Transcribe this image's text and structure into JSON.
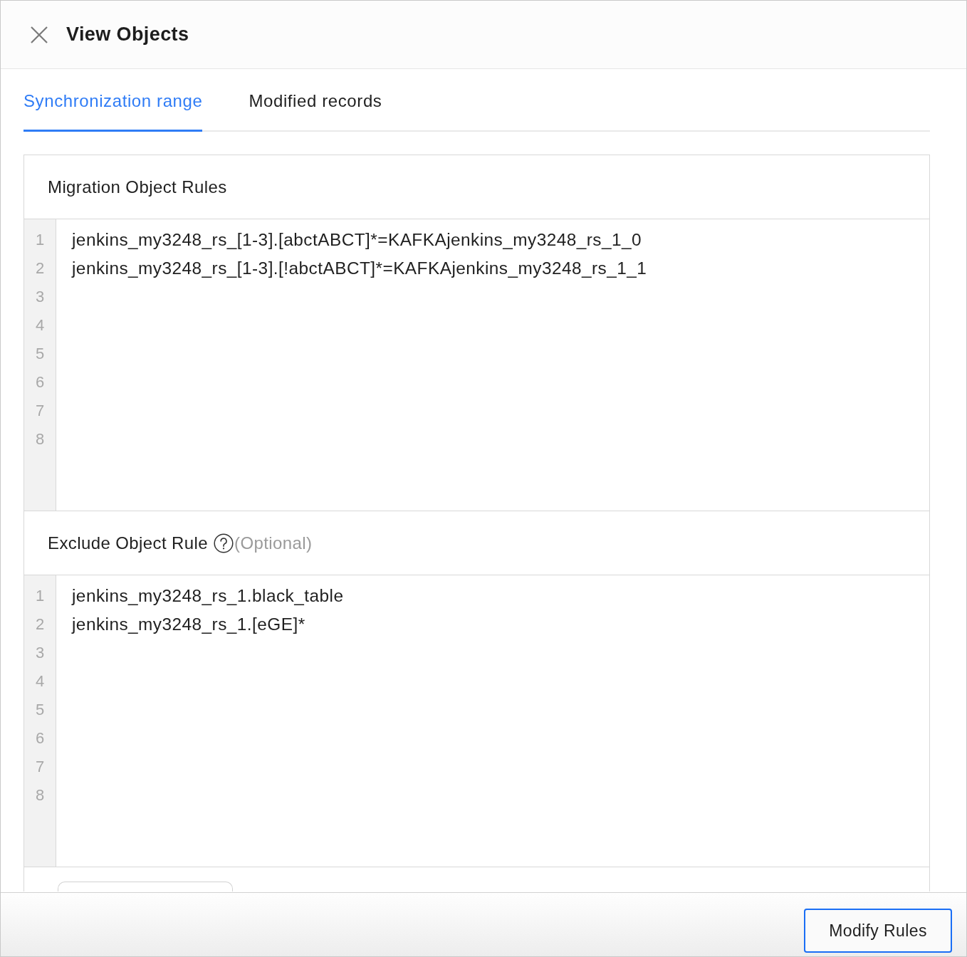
{
  "window": {
    "title": "View Objects"
  },
  "tabs": [
    {
      "label": "Synchronization range",
      "selected": true
    },
    {
      "label": "Modified records",
      "selected": false
    }
  ],
  "sections": [
    {
      "title": "Migration Object Rules",
      "help_icon": false,
      "lines": [
        {
          "number": "1",
          "text": "jenkins_my3248_rs_[1-3].[abctABCT]*=KAFKAjenkins_my3248_rs_1_0"
        },
        {
          "number": "2",
          "text": "jenkins_my3248_rs_[1-3].[!abctABCT]*=KAFKAjenkins_my3248_rs_1_1"
        },
        {
          "number": "3"
        },
        {
          "number": "4"
        },
        {
          "number": "5"
        },
        {
          "number": "6"
        },
        {
          "number": "7"
        },
        {
          "number": "8"
        }
      ]
    },
    {
      "title": "Exclude Object Rule",
      "help_icon": true,
      "hint": "(Optional)",
      "lines": [
        {
          "number": "1",
          "text": "jenkins_my3248_rs_1.black_table"
        },
        {
          "number": "2",
          "text": "jenkins_my3248_rs_1.[eGE]*"
        },
        {
          "number": "3"
        },
        {
          "number": "4"
        },
        {
          "number": "5"
        },
        {
          "number": "6"
        },
        {
          "number": "7"
        },
        {
          "number": "8"
        }
      ]
    }
  ],
  "footer": {
    "button": {
      "label": "Modify Rules",
      "focused": true
    }
  }
}
